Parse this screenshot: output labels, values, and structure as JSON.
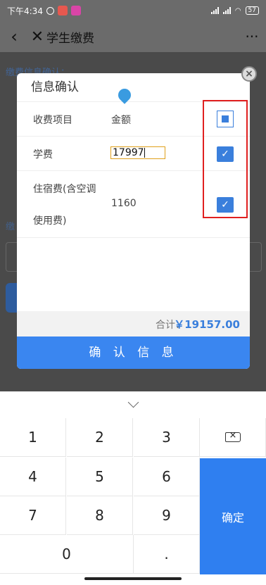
{
  "status": {
    "time": "下午4:34",
    "battery": "57"
  },
  "nav": {
    "title": "学生缴费",
    "back_icon": "‹",
    "close_icon": "✕",
    "more_icon": "···"
  },
  "background": {
    "section1": "缴费信息确认：",
    "section2": "缴"
  },
  "dialog": {
    "title": "信息确认",
    "header": {
      "item": "收费项目",
      "amount": "金额"
    },
    "rows": [
      {
        "name": "学费",
        "amount": "17997",
        "checked": true
      },
      {
        "name_line1": "住宿费(含空调",
        "name_line2": "使用费)",
        "amount": "1160",
        "checked": true
      }
    ],
    "total_label": "合计：",
    "total_value": "￥19157.00",
    "confirm": "确 认 信 息"
  },
  "keypad": {
    "keys": [
      "1",
      "2",
      "3",
      "4",
      "5",
      "6",
      "7",
      "8",
      "9",
      "0",
      "."
    ],
    "ok": "确定"
  },
  "colors": {
    "accent": "#3a86f0",
    "highlight_frame": "#e02020"
  }
}
